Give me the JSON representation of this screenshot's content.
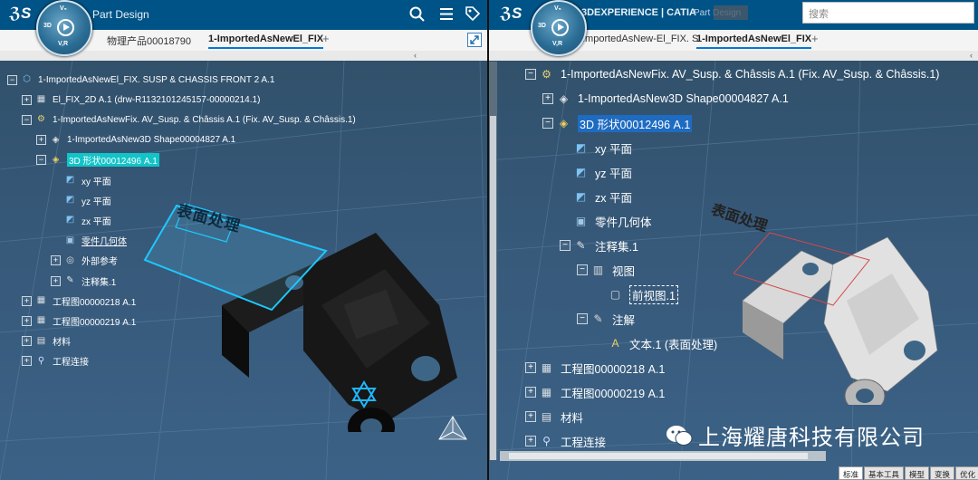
{
  "left": {
    "app_title": "Part Design",
    "compass": {
      "top": "V₅",
      "left": "3D",
      "bottom": "V,R"
    },
    "tabs": [
      "物理产品00018790",
      "1-ImportedAsNewEl_FIX"
    ],
    "tree": [
      {
        "label": "1-ImportedAsNewEl_FIX. SUSP & CHASSIS FRONT 2 A.1",
        "icon": "product-icon",
        "level": 0,
        "exp": "−"
      },
      {
        "label": "El_FIX_2D A.1 (drw-R1132101245157-00000214.1)",
        "icon": "drawing-icon",
        "level": 1,
        "exp": "+"
      },
      {
        "label": "1-ImportedAsNewFix. AV_Susp. & Châssis A.1 (Fix. AV_Susp. & Châssis.1)",
        "icon": "part-icon",
        "level": 1,
        "exp": "−"
      },
      {
        "label": "1-ImportedAsNew3D Shape00004827 A.1",
        "icon": "shape-icon",
        "level": 2,
        "exp": "+"
      },
      {
        "label": "3D 形状00012496 A.1",
        "icon": "shape-active-icon",
        "level": 2,
        "exp": "−",
        "highlight": "cyan"
      },
      {
        "label": "xy 平面",
        "icon": "plane-icon",
        "level": 3
      },
      {
        "label": "yz 平面",
        "icon": "plane-icon",
        "level": 3
      },
      {
        "label": "zx 平面",
        "icon": "plane-icon",
        "level": 3
      },
      {
        "label": "零件几何体",
        "icon": "body-icon",
        "level": 3,
        "underline": true
      },
      {
        "label": "外部参考",
        "icon": "reference-icon",
        "level": 3,
        "exp": "+"
      },
      {
        "label": "注释集.1",
        "icon": "annotation-set-icon",
        "level": 3,
        "exp": "+"
      },
      {
        "label": "工程图00000218 A.1",
        "icon": "drawing-icon",
        "level": 1,
        "exp": "+"
      },
      {
        "label": "工程图00000219 A.1",
        "icon": "drawing-icon",
        "level": 1,
        "exp": "+"
      },
      {
        "label": "材料",
        "icon": "material-icon",
        "level": 1,
        "exp": "+"
      },
      {
        "label": "工程连接",
        "icon": "connection-icon",
        "level": 1,
        "exp": "+"
      }
    ],
    "annotation_text": "表面处理"
  },
  "right": {
    "brand": "3DEXPERIENCE | CATIA",
    "app_title": "Part Design",
    "search_placeholder": "搜索",
    "compass": {
      "top": "V₅",
      "left": "3D",
      "bottom": "V,R"
    },
    "tabs": [
      "ImportedAsNew-El_FIX. S",
      "1-ImportedAsNewEl_FIX"
    ],
    "tree": [
      {
        "label": "1-ImportedAsNewFix. AV_Susp. & Châssis A.1 (Fix. AV_Susp. & Châssis.1)",
        "icon": "part-icon",
        "level": 0,
        "exp": "−"
      },
      {
        "label": "1-ImportedAsNew3D Shape00004827 A.1",
        "icon": "shape-icon",
        "level": 1,
        "exp": "+"
      },
      {
        "label": "3D 形状00012496 A.1",
        "icon": "shape-active-icon",
        "level": 1,
        "exp": "−",
        "highlight": "blue"
      },
      {
        "label": "xy 平面",
        "icon": "plane-icon",
        "level": 2
      },
      {
        "label": "yz 平面",
        "icon": "plane-icon",
        "level": 2
      },
      {
        "label": "zx 平面",
        "icon": "plane-icon",
        "level": 2
      },
      {
        "label": "零件几何体",
        "icon": "body-icon",
        "level": 2
      },
      {
        "label": "注释集.1",
        "icon": "annotation-set-icon",
        "level": 2,
        "exp": "−"
      },
      {
        "label": "视图",
        "icon": "view-icon",
        "level": 3,
        "exp": "−"
      },
      {
        "label": "前视图.1",
        "icon": "front-view-icon",
        "level": 4,
        "highlight": "box"
      },
      {
        "label": "注解",
        "icon": "note-icon",
        "level": 3,
        "exp": "−"
      },
      {
        "label": "文本.1 (表面处理)",
        "icon": "text-icon",
        "level": 4
      },
      {
        "label": "工程图00000218 A.1",
        "icon": "drawing-icon",
        "level": 0,
        "exp": "+"
      },
      {
        "label": "工程图00000219 A.1",
        "icon": "drawing-icon",
        "level": 0,
        "exp": "+"
      },
      {
        "label": "材料",
        "icon": "material-icon",
        "level": 0,
        "exp": "+"
      },
      {
        "label": "工程连接",
        "icon": "connection-icon",
        "level": 0,
        "exp": "+"
      }
    ],
    "annotation_text": "表面处理",
    "bottom_tabs": [
      "标准",
      "基本工具",
      "模型",
      "变换",
      "优化"
    ],
    "watermark": "上海耀唐科技有限公司"
  }
}
